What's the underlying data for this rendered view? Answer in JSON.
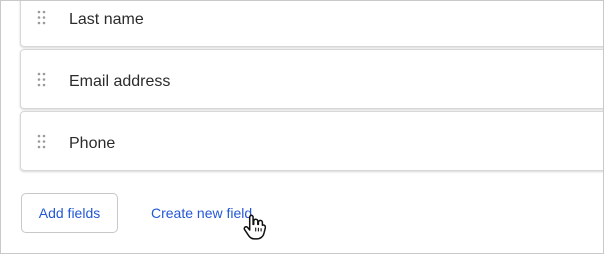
{
  "fields": [
    {
      "label": "Last name",
      "icon": "drag-handle-icon"
    },
    {
      "label": "Email address",
      "icon": "drag-handle-icon"
    },
    {
      "label": "Phone",
      "icon": "drag-handle-icon"
    }
  ],
  "actions": {
    "add_fields_label": "Add fields",
    "create_new_field_label": "Create new field"
  },
  "cursor": {
    "icon": "hand-pointer-icon"
  },
  "colors": {
    "accent": "#2457d6",
    "text": "#2b2b2b",
    "border": "#d7d7d7",
    "handle": "#9b9b9b"
  }
}
